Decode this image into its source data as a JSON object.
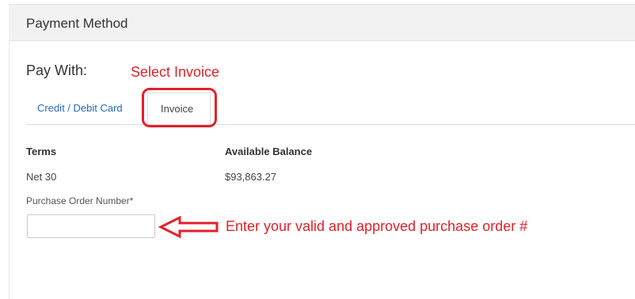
{
  "panel": {
    "title": "Payment Method"
  },
  "pay_with": {
    "label": "Pay With:",
    "tabs": [
      {
        "label": "Credit / Debit Card",
        "active": false
      },
      {
        "label": "Invoice",
        "active": true
      }
    ]
  },
  "invoice": {
    "terms_header": "Terms",
    "terms_value": "Net 30",
    "balance_header": "Available Balance",
    "balance_value": "$93,863.27",
    "po_label": "Purchase Order Number*",
    "po_value": ""
  },
  "annotations": {
    "select_invoice": "Select Invoice",
    "enter_po": "Enter your valid and approved purchase order #",
    "color": "#e2212a",
    "arrow_icon": "left-arrow-outline-icon"
  },
  "colors": {
    "link": "#2a6ab5",
    "header_bg": "#f2f2f2"
  }
}
